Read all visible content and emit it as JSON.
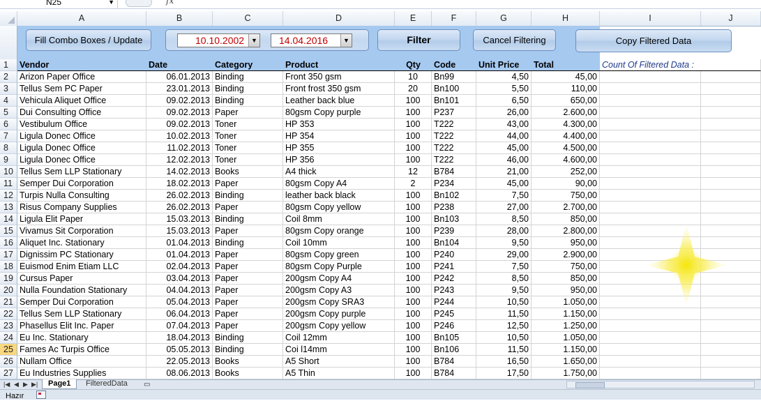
{
  "formula_bar": {
    "name_box": "N25",
    "fx": "fx"
  },
  "columns": [
    "A",
    "B",
    "C",
    "D",
    "E",
    "F",
    "G",
    "H",
    "I",
    "J"
  ],
  "buttons": {
    "fill_combo": "Fill Combo Boxes / Update",
    "filter": "Filter",
    "cancel_filter": "Cancel Filtering",
    "copy_filtered": "Copy Filtered Data"
  },
  "date_from": "10.10.2002",
  "date_to": "14.04.2016",
  "headers": {
    "row_num": "1",
    "vendor": "Vendor",
    "date": "Date",
    "category": "Category",
    "product": "Product",
    "qty": "Qty",
    "code": "Code",
    "unit_price": "Unit Price",
    "total": "Total",
    "count_label": "Count Of Filtered Data :"
  },
  "rows": [
    {
      "n": "2",
      "vendor": "Arizon Paper Office",
      "date": "06.01.2013",
      "category": "Binding",
      "product": "Front 350 gsm",
      "qty": "10",
      "code": "Bn99",
      "price": "4,50",
      "total": "45,00"
    },
    {
      "n": "3",
      "vendor": "Tellus Sem PC Paper",
      "date": "23.01.2013",
      "category": "Binding",
      "product": "Front frost 350 gsm",
      "qty": "20",
      "code": "Bn100",
      "price": "5,50",
      "total": "110,00"
    },
    {
      "n": "4",
      "vendor": "Vehicula Aliquet Office",
      "date": "09.02.2013",
      "category": "Binding",
      "product": "Leather back blue",
      "qty": "100",
      "code": "Bn101",
      "price": "6,50",
      "total": "650,00"
    },
    {
      "n": "5",
      "vendor": "Dui Consulting Office",
      "date": "09.02.2013",
      "category": "Paper",
      "product": "80gsm Copy purple",
      "qty": "100",
      "code": "P237",
      "price": "26,00",
      "total": "2.600,00"
    },
    {
      "n": "6",
      "vendor": "Vestibulum  Office",
      "date": "09.02.2013",
      "category": "Toner",
      "product": "HP 353",
      "qty": "100",
      "code": "T222",
      "price": "43,00",
      "total": "4.300,00"
    },
    {
      "n": "7",
      "vendor": "Ligula Donec Office",
      "date": "10.02.2013",
      "category": "Toner",
      "product": "HP 354",
      "qty": "100",
      "code": "T222",
      "price": "44,00",
      "total": "4.400,00"
    },
    {
      "n": "8",
      "vendor": "Ligula Donec Office",
      "date": "11.02.2013",
      "category": "Toner",
      "product": "HP 355",
      "qty": "100",
      "code": "T222",
      "price": "45,00",
      "total": "4.500,00"
    },
    {
      "n": "9",
      "vendor": "Ligula Donec Office",
      "date": "12.02.2013",
      "category": "Toner",
      "product": "HP 356",
      "qty": "100",
      "code": "T222",
      "price": "46,00",
      "total": "4.600,00"
    },
    {
      "n": "10",
      "vendor": "Tellus Sem LLP Stationary",
      "date": "14.02.2013",
      "category": "Books",
      "product": "A4 thick",
      "qty": "12",
      "code": "B784",
      "price": "21,00",
      "total": "252,00"
    },
    {
      "n": "11",
      "vendor": "Semper Dui Corporation",
      "date": "18.02.2013",
      "category": "Paper",
      "product": "80gsm Copy A4",
      "qty": "2",
      "code": "P234",
      "price": "45,00",
      "total": "90,00"
    },
    {
      "n": "12",
      "vendor": "Turpis Nulla Consulting",
      "date": "26.02.2013",
      "category": "Binding",
      "product": "leather back black",
      "qty": "100",
      "code": "Bn102",
      "price": "7,50",
      "total": "750,00"
    },
    {
      "n": "13",
      "vendor": "Risus Company Supplies",
      "date": "26.02.2013",
      "category": "Paper",
      "product": "80gsm Copy yellow",
      "qty": "100",
      "code": "P238",
      "price": "27,00",
      "total": "2.700,00"
    },
    {
      "n": "14",
      "vendor": "Ligula Elit Paper",
      "date": "15.03.2013",
      "category": "Binding",
      "product": "Coil 8mm",
      "qty": "100",
      "code": "Bn103",
      "price": "8,50",
      "total": "850,00"
    },
    {
      "n": "15",
      "vendor": "Vivamus Sit Corporation",
      "date": "15.03.2013",
      "category": "Paper",
      "product": "80gsm Copy orange",
      "qty": "100",
      "code": "P239",
      "price": "28,00",
      "total": "2.800,00"
    },
    {
      "n": "16",
      "vendor": "Aliquet Inc. Stationary",
      "date": "01.04.2013",
      "category": "Binding",
      "product": "Coil 10mm",
      "qty": "100",
      "code": "Bn104",
      "price": "9,50",
      "total": "950,00"
    },
    {
      "n": "17",
      "vendor": "Dignissim PC Stationary",
      "date": "01.04.2013",
      "category": "Paper",
      "product": "80gsm Copy green",
      "qty": "100",
      "code": "P240",
      "price": "29,00",
      "total": "2.900,00"
    },
    {
      "n": "18",
      "vendor": "Euismod Enim Etiam LLC",
      "date": "02.04.2013",
      "category": "Paper",
      "product": "80gsm Copy Purple",
      "qty": "100",
      "code": "P241",
      "price": "7,50",
      "total": "750,00"
    },
    {
      "n": "19",
      "vendor": "Cursus  Paper",
      "date": "03.04.2013",
      "category": "Paper",
      "product": "200gsm Copy A4",
      "qty": "100",
      "code": "P242",
      "price": "8,50",
      "total": "850,00"
    },
    {
      "n": "20",
      "vendor": "Nulla Foundation Stationary",
      "date": "04.04.2013",
      "category": "Paper",
      "product": "200gsm Copy A3",
      "qty": "100",
      "code": "P243",
      "price": "9,50",
      "total": "950,00"
    },
    {
      "n": "21",
      "vendor": "Semper Dui Corporation",
      "date": "05.04.2013",
      "category": "Paper",
      "product": "200gsm Copy SRA3",
      "qty": "100",
      "code": "P244",
      "price": "10,50",
      "total": "1.050,00"
    },
    {
      "n": "22",
      "vendor": "Tellus Sem LLP Stationary",
      "date": "06.04.2013",
      "category": "Paper",
      "product": "200gsm Copy purple",
      "qty": "100",
      "code": "P245",
      "price": "11,50",
      "total": "1.150,00"
    },
    {
      "n": "23",
      "vendor": "Phasellus Elit Inc. Paper",
      "date": "07.04.2013",
      "category": "Paper",
      "product": "200gsm Copy yellow",
      "qty": "100",
      "code": "P246",
      "price": "12,50",
      "total": "1.250,00"
    },
    {
      "n": "24",
      "vendor": "Eu Inc. Stationary",
      "date": "18.04.2013",
      "category": "Binding",
      "product": "Coil 12mm",
      "qty": "100",
      "code": "Bn105",
      "price": "10,50",
      "total": "1.050,00"
    },
    {
      "n": "25",
      "vendor": "Fames Ac Turpis  Office",
      "date": "05.05.2013",
      "category": "Binding",
      "product": "Coi l14mm",
      "qty": "100",
      "code": "Bn106",
      "price": "11,50",
      "total": "1.150,00"
    },
    {
      "n": "26",
      "vendor": "Nullam  Office",
      "date": "22.05.2013",
      "category": "Books",
      "product": "A5 Short",
      "qty": "100",
      "code": "B784",
      "price": "16,50",
      "total": "1.650,00"
    },
    {
      "n": "27",
      "vendor": "Eu Industries Supplies",
      "date": "08.06.2013",
      "category": "Books",
      "product": "A5 Thin",
      "qty": "100",
      "code": "B784",
      "price": "17,50",
      "total": "1.750,00"
    }
  ],
  "selected_row": "25",
  "tabs": {
    "active": "Page1",
    "other": "FilteredData"
  },
  "status": {
    "text": "Hazır"
  }
}
